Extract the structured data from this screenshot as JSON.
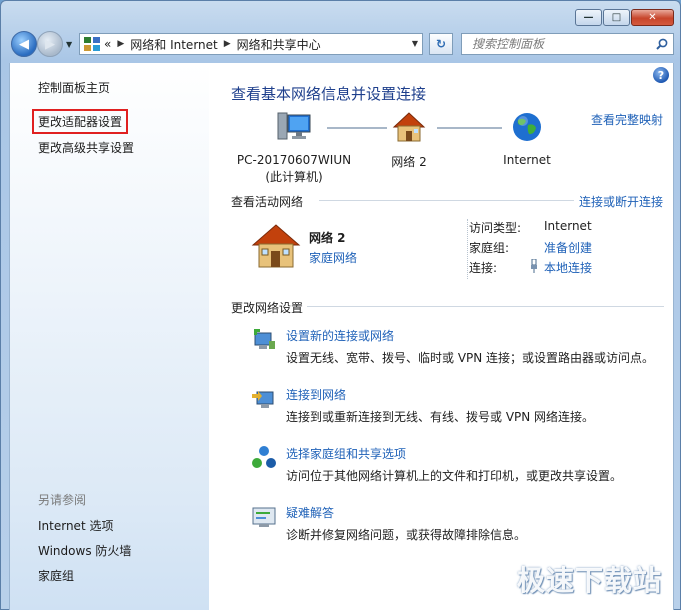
{
  "window": {
    "minimize": "—",
    "maximize": "□",
    "close": "✕"
  },
  "nav": {
    "back": "◀",
    "forward": "▶",
    "breadcrumb": [
      "«",
      "网络和 Internet",
      "网络和共享中心"
    ],
    "refresh": "↻",
    "search_placeholder": "搜索控制面板"
  },
  "sidebar": {
    "links": [
      "控制面板主页",
      "更改适配器设置",
      "更改高级共享设置"
    ],
    "see_also_title": "另请参阅",
    "see_also": [
      "Internet 选项",
      "Windows 防火墙",
      "家庭组"
    ]
  },
  "main": {
    "title": "查看基本网络信息并设置连接",
    "view_full_map": "查看完整映射",
    "map": {
      "computer_name": "PC-20170607WIUN",
      "computer_sub": "(此计算机)",
      "network": "网络  2",
      "internet": "Internet"
    },
    "active": {
      "title": "查看活动网络",
      "connect_link": "连接或断开连接",
      "name": "网络  2",
      "type": "家庭网络",
      "access_label": "访问类型:",
      "access_value": "Internet",
      "homegroup_label": "家庭组:",
      "homegroup_value": "准备创建",
      "conn_label": "连接:",
      "conn_value": "本地连接"
    },
    "change": {
      "title": "更改网络设置",
      "tasks": [
        {
          "title": "设置新的连接或网络",
          "desc": "设置无线、宽带、拨号、临时或 VPN 连接；或设置路由器或访问点。"
        },
        {
          "title": "连接到网络",
          "desc": "连接到或重新连接到无线、有线、拨号或 VPN 网络连接。"
        },
        {
          "title": "选择家庭组和共享选项",
          "desc": "访问位于其他网络计算机上的文件和打印机，或更改共享设置。"
        },
        {
          "title": "疑难解答",
          "desc": "诊断并修复网络问题，或获得故障排除信息。"
        }
      ]
    }
  },
  "watermark": "极速下载站"
}
